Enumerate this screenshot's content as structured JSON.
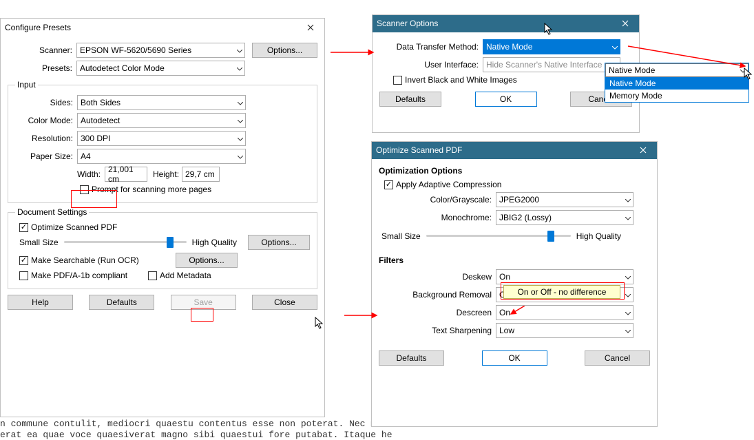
{
  "bg_text": "n commune contulit, mediocri quaestu contentus esse non poterat. Nec miru\nerat ea quae voce quaesiverat magno sibi quaestui fore putabat. Itaque he",
  "configure": {
    "title": "Configure Presets",
    "scanner_label": "Scanner:",
    "scanner_value": "EPSON WF-5620/5690 Series",
    "options_btn": "Options...",
    "presets_label": "Presets:",
    "presets_value": "Autodetect Color Mode",
    "input_legend": "Input",
    "sides_label": "Sides:",
    "sides_value": "Both Sides",
    "colormode_label": "Color Mode:",
    "colormode_value": "Autodetect",
    "resolution_label": "Resolution:",
    "resolution_value": "300 DPI",
    "papersize_label": "Paper Size:",
    "papersize_value": "A4",
    "width_label": "Width:",
    "width_value": "21,001 cm",
    "height_label": "Height:",
    "height_value": "29,7 cm",
    "prompt_label": "Prompt for scanning more pages",
    "docset_legend": "Document Settings",
    "optimize_label": "Optimize Scanned PDF",
    "smallsize": "Small Size",
    "highquality": "High Quality",
    "options2": "Options...",
    "ocr_label": "Make Searchable (Run OCR)",
    "options3": "Options...",
    "pdfa_label": "Make PDF/A-1b compliant",
    "addmeta_label": "Add Metadata",
    "help": "Help",
    "defaults": "Defaults",
    "save": "Save",
    "close": "Close"
  },
  "scanopts": {
    "title": "Scanner Options",
    "dtm_label": "Data Transfer Method:",
    "dtm_value": "Native Mode",
    "ui_label": "User Interface:",
    "ui_value": "Hide Scanner's Native Interface",
    "invert_label": "Invert Black and White Images",
    "defaults": "Defaults",
    "ok": "OK",
    "cancel": "Cancel"
  },
  "dropdown": {
    "selected": "Native Mode",
    "opt1": "Native Mode",
    "opt2": "Memory Mode"
  },
  "optimize": {
    "title": "Optimize Scanned PDF",
    "opt_heading": "Optimization Options",
    "adaptive_label": "Apply Adaptive Compression",
    "colorgray_label": "Color/Grayscale:",
    "colorgray_value": "JPEG2000",
    "mono_label": "Monochrome:",
    "mono_value": "JBIG2 (Lossy)",
    "smallsize": "Small Size",
    "highquality": "High Quality",
    "filters_heading": "Filters",
    "note": "On or Off - no difference",
    "deskew_label": "Deskew",
    "deskew_value": "On",
    "bgrem_label": "Background Removal",
    "bgrem_value": "Off",
    "descreen_label": "Descreen",
    "descreen_value": "On",
    "sharpen_label": "Text Sharpening",
    "sharpen_value": "Low",
    "defaults": "Defaults",
    "ok": "OK",
    "cancel": "Cancel"
  }
}
